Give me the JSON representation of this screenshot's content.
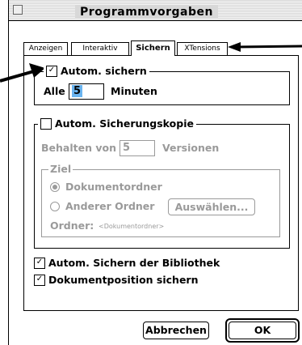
{
  "window": {
    "title": "Programmvorgaben"
  },
  "tabs": [
    {
      "label": "Anzeigen"
    },
    {
      "label": "Interaktiv"
    },
    {
      "label": "Sichern",
      "active": true
    },
    {
      "label": "XTensions"
    }
  ],
  "autosave": {
    "title": "Autom. sichern",
    "checked": true,
    "every_label": "Alle",
    "interval_value": "5",
    "unit_label": "Minuten"
  },
  "backup": {
    "title": "Autom. Sicherungskopie",
    "checked": false,
    "keep_label": "Behalten von",
    "keep_value": "5",
    "versions_label": "Versionen",
    "target": {
      "title": "Ziel",
      "option_docfolder": "Dokumentordner",
      "option_other": "Anderer Ordner",
      "choose_button": "Auswählen...",
      "folder_label": "Ordner:",
      "folder_value": "<Dokumentordner>"
    }
  },
  "options": [
    {
      "label": "Autom. Sichern der Bibliothek",
      "checked": true
    },
    {
      "label": "Dokumentposition sichern",
      "checked": true
    }
  ],
  "buttons": {
    "cancel": "Abbrechen",
    "ok": "OK"
  },
  "colors": {
    "disabled": "#9a9a9a",
    "field_highlight": "#6ab4f0",
    "titlebar": "#d8d8d8"
  }
}
